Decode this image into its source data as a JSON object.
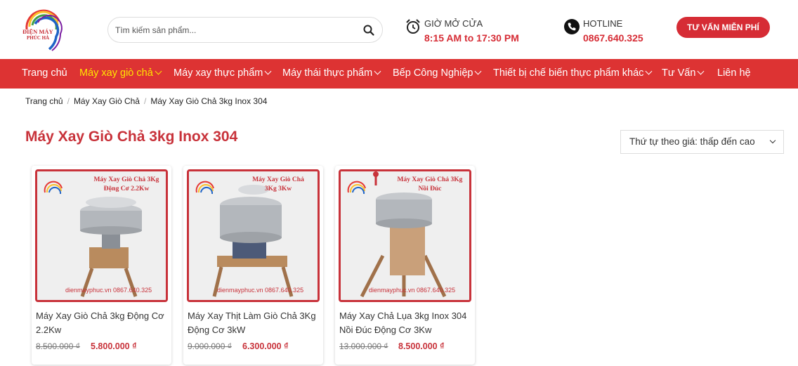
{
  "brand": {
    "logo_line1": "ĐIỆN MÁY",
    "logo_line2": "PHÚC HÀ"
  },
  "search": {
    "placeholder": "Tìm kiếm sản phẩm..."
  },
  "hours": {
    "label": "Giờ mở cửa",
    "value": "8:15 AM to 17:30 PM"
  },
  "hotline": {
    "label": "HOTLINE",
    "value": "0867.640.325"
  },
  "cta_label": "TƯ VẤN MIỄN PHÍ",
  "nav": {
    "items": [
      {
        "label": "Trang chủ"
      },
      {
        "label": "Máy xay giò chả"
      },
      {
        "label": "Máy xay thực phẩm"
      },
      {
        "label": "Máy thái thực phẩm"
      },
      {
        "label": "Bếp Công Nghiệp"
      },
      {
        "label": "Thiết bị chế biến thực phẩm khác"
      },
      {
        "label": "Tư Vấn"
      },
      {
        "label": "Liên hệ"
      }
    ]
  },
  "breadcrumb": {
    "items": [
      "Trang chủ",
      "Máy Xay Giò Chả",
      "Máy Xay Giò Chả 3kg Inox 304"
    ],
    "separator": "/"
  },
  "page_title": "Máy Xay Giò Chả 3kg Inox 304",
  "sort": {
    "selected": "Thứ tự theo giá: thấp đến cao"
  },
  "products": [
    {
      "image_caption_1": "Máy Xay Giò Chả 3Kg",
      "image_caption_2": "Động Cơ 2.2Kw",
      "image_footer": "dienmayphuc.vn 0867.640.325",
      "name": "Máy Xay Giò Chả 3kg Động Cơ 2.2Kw",
      "old_price": "8.500.000 ₫",
      "new_price": "5.800.000 ₫"
    },
    {
      "image_caption_1": "Máy Xay Giò Chả",
      "image_caption_2": "3Kg 3Kw",
      "image_footer": "dienmayphuc.vn 0867.640.325",
      "name": "Máy Xay Thịt Làm Giò Chả 3Kg Động Cơ 3kW",
      "old_price": "9.000.000 ₫",
      "new_price": "6.300.000 ₫"
    },
    {
      "image_caption_1": "Máy Xay Giò Chả 3Kg",
      "image_caption_2": "Nồi Đúc",
      "image_footer": "dienmayphuc.vn 0867.640.325",
      "name": "Máy Xay Chả Lụa 3kg Inox 304 Nồi Đúc Động Cơ 3Kw",
      "old_price": "13.000.000 ₫",
      "new_price": "8.500.000 ₫"
    }
  ],
  "colors": {
    "brand_red": "#dd3333",
    "title_red": "#c8323a",
    "active_nav": "#ffe600"
  }
}
